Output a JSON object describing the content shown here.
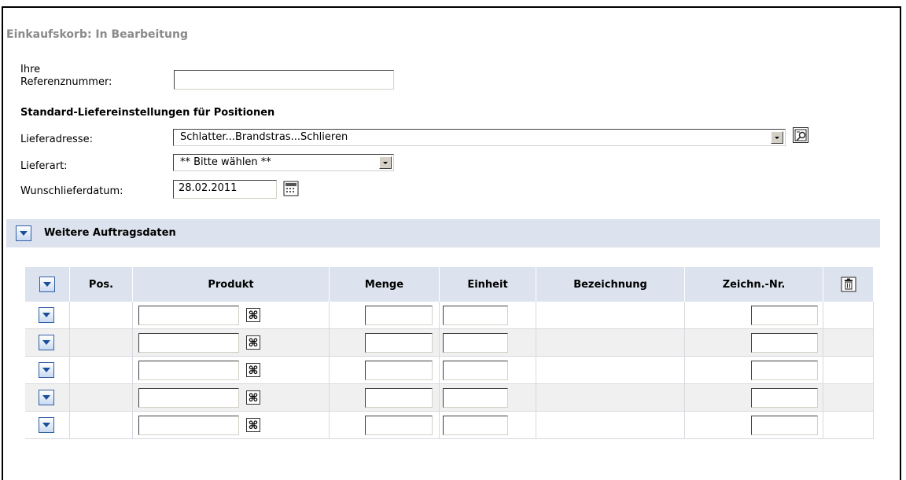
{
  "page": {
    "title": "Einkaufskorb: In Bearbeitung"
  },
  "form": {
    "reference_label_line1": "Ihre",
    "reference_label_line2": "Referenznummer:",
    "reference_value": "",
    "section_title": "Standard-Liefereinstellungen für Positionen",
    "address_label": "Lieferadresse:",
    "address_value": "Schlatter...Brandstras...Schlieren",
    "delivery_type_label": "Lieferart:",
    "delivery_type_value": "** Bitte wählen **",
    "date_label": "Wunschlieferdatum:",
    "date_value": "28.02.2011"
  },
  "more_data": {
    "label": "Weitere Auftragsdaten"
  },
  "table": {
    "headers": {
      "pos": "Pos.",
      "product": "Produkt",
      "quantity": "Menge",
      "unit": "Einheit",
      "description": "Bezeichnung",
      "drawing": "Zeichn.-Nr."
    },
    "rows": [
      {
        "pos": "",
        "product": "",
        "quantity": "",
        "unit": "",
        "description": "",
        "drawing": ""
      },
      {
        "pos": "",
        "product": "",
        "quantity": "",
        "unit": "",
        "description": "",
        "drawing": ""
      },
      {
        "pos": "",
        "product": "",
        "quantity": "",
        "unit": "",
        "description": "",
        "drawing": ""
      },
      {
        "pos": "",
        "product": "",
        "quantity": "",
        "unit": "",
        "description": "",
        "drawing": ""
      },
      {
        "pos": "",
        "product": "",
        "quantity": "",
        "unit": "",
        "description": "",
        "drawing": ""
      }
    ]
  },
  "icons": {
    "address_lookup": "address-search-icon",
    "calendar": "calendar-icon",
    "expand": "chevron-down-icon",
    "delete": "trash-icon",
    "product_search": "binoculars-icon"
  }
}
